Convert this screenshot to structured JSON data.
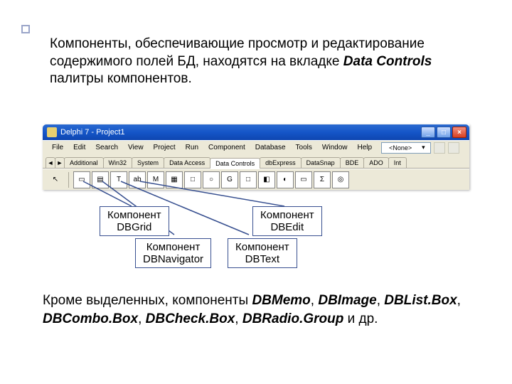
{
  "intro": {
    "before": "Компоненты, обеспечивающие просмотр и редактирование содержимого полей БД, находятся на вкладке ",
    "em": "Data Controls",
    "after": " палитры компонентов."
  },
  "window": {
    "title": "Delphi 7 - Project1",
    "minimize": "_",
    "maximize": "□",
    "close": "×"
  },
  "menu": {
    "items": [
      "File",
      "Edit",
      "Search",
      "View",
      "Project",
      "Run",
      "Component",
      "Database",
      "Tools",
      "Window",
      "Help"
    ],
    "selector_value": "<None>",
    "selector_arrow": "▾"
  },
  "tabs": {
    "arrow_left": "◄",
    "arrow_right": "►",
    "list": [
      "Additional",
      "Win32",
      "System",
      "Data Access",
      "Data Controls",
      "dbExpress",
      "DataSnap",
      "BDE",
      "ADO",
      "Int"
    ],
    "active_index": 4
  },
  "palette_icons": [
    "▭",
    "▤",
    "T",
    "ab",
    "M",
    "▦",
    "□",
    "○",
    "G",
    "□",
    "◧",
    "◐",
    "▭",
    "Σ",
    "◎"
  ],
  "callouts": {
    "dbgrid": "Компонент\nDBGrid",
    "dbedit": "Компонент\nDBEdit",
    "dbnavigator": "Компонент\nDBNavigator",
    "dbtext": "Компонент\nDBText"
  },
  "outro": {
    "t1": "Кроме выделенных, компоненты ",
    "e1": "DBMemo",
    "t2": ", ",
    "e2": "DBImage",
    "t3": ", ",
    "e3": "DBList.Box",
    "t4": ", ",
    "e4": "DBCombo.Box",
    "t5": ", ",
    "e5": "DBCheck.Box",
    "t6": ", ",
    "e6": "DBRadio.Group",
    "t7": " и др."
  }
}
